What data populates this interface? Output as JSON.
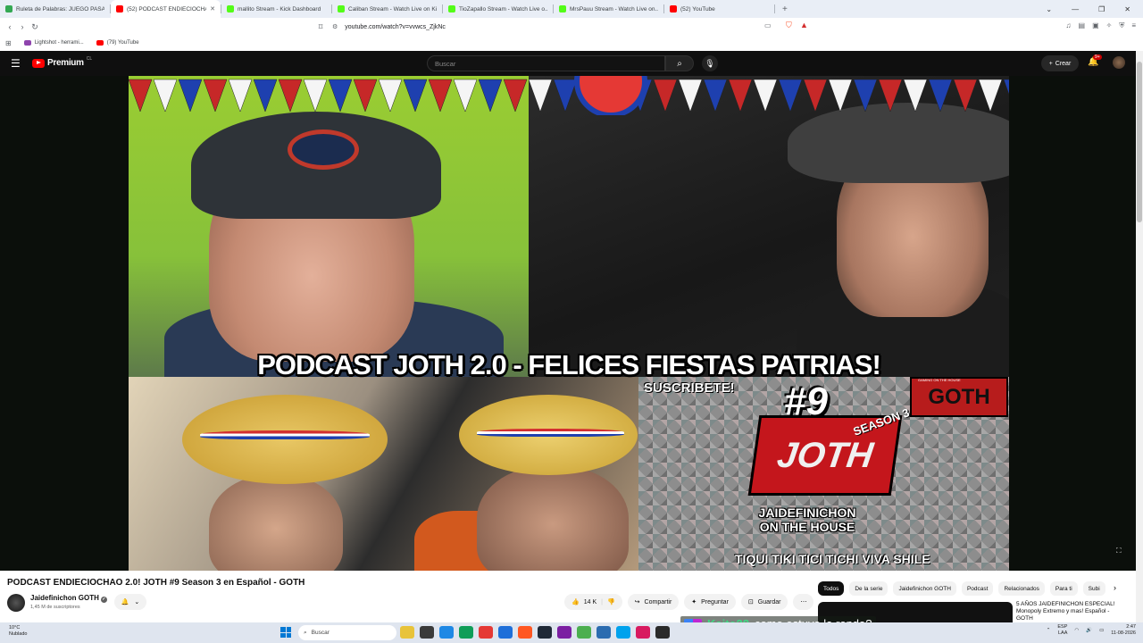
{
  "browser": {
    "tabs": [
      {
        "title": "Ruleta de Palabras: JUEGO PASAPALA...",
        "color": "#34a853",
        "active": false
      },
      {
        "title": "(52) PODCAST ENDIECIOCHAO",
        "color": "#ff0000",
        "active": true
      },
      {
        "title": "mallito Stream - Kick Dashboard",
        "color": "#53fc18",
        "active": false
      },
      {
        "title": "Caliban Stream - Watch Live on Kick",
        "color": "#53fc18",
        "active": false
      },
      {
        "title": "TioZapallo Stream - Watch Live o...",
        "color": "#53fc18",
        "active": false
      },
      {
        "title": "MrsPauu Stream - Watch Live on...",
        "color": "#53fc18",
        "active": false
      },
      {
        "title": "(52) YouTube",
        "color": "#ff0000",
        "active": false
      }
    ],
    "url": "youtube.com/watch?v=vvwcs_ZjkNc",
    "bookmarks": [
      {
        "label": "Lightshot - herrami...",
        "color": "#8e44ad"
      },
      {
        "label": "(79) YouTube",
        "color": "#ff0000"
      }
    ]
  },
  "youtube": {
    "logo_text": "Premium",
    "country_code": "CL",
    "search_placeholder": "Buscar",
    "create_label": "Crear",
    "notif_count": "9+"
  },
  "video": {
    "overlay_caption": "PODCAST JOTH 2.0 - FELICES FIESTAS PATRIAS!",
    "subscribe_text": "SUSCRIBETE!",
    "episode_number": "#9",
    "season_text": "SEASON 3",
    "joth_logo": "JOTH",
    "goth_logo": "GOTH",
    "goth_small": "GAMING ON THE HOUSE",
    "brand_line1": "JAIDEFINICHON",
    "brand_line2": "ON THE HOUSE",
    "footer_text": "TIQUI TIKI TICI TICHI VIVA SHILE",
    "title": "PODCAST ENDIECIOCHAO 2.0! JOTH #9 Season 3 en Español - GOTH"
  },
  "channel": {
    "name": "Jaidefinichon GOTH",
    "subscribers": "1,45 M de suscriptores"
  },
  "actions": {
    "likes": "14 K",
    "share": "Compartir",
    "ask": "Preguntar",
    "save": "Guardar"
  },
  "chips": [
    "Todos",
    "De la serie",
    "Jaidefinichon GOTH",
    "Podcast",
    "Relacionados",
    "Para ti",
    "Subi"
  ],
  "related": {
    "title": "5 AÑOS JAIDEFINICHON ESPECIAL! Monopoly Extremo y mas! Español - GOTH"
  },
  "chat": {
    "user": "Kaito28",
    "message": "como estuvo la ronda?"
  },
  "taskbar": {
    "temp": "10°C",
    "weather": "Nublado",
    "search": "Buscar",
    "lang1": "ESP",
    "lang2": "LAA",
    "time": "2:47",
    "date": "11-08-2026",
    "app_colors": [
      "#e8c33a",
      "#3a3a3a",
      "#1e88e5",
      "#0f9d58",
      "#e53935",
      "#1e6fd9",
      "#ff5722",
      "#1f2937",
      "#7b1fa2",
      "#4caf50",
      "#2b6cb0",
      "#00a2ed",
      "#d81b60",
      "#2a2a2a"
    ]
  },
  "colors": {
    "yt_red": "#ff0000",
    "yt_dark": "#0f0f0f",
    "chat_user": "#3ddc84"
  }
}
